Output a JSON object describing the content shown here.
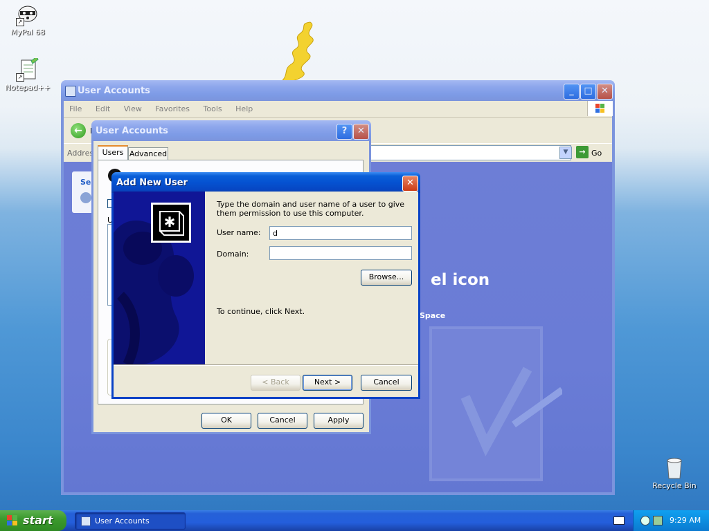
{
  "desktop": {
    "icons": [
      {
        "label": "MyPal 68",
        "icon": "raccoon-icon"
      },
      {
        "label": "Notepad++",
        "icon": "notepad-plus-icon"
      },
      {
        "label": "Recycle Bin",
        "icon": "recycle-bin-icon"
      }
    ]
  },
  "main_window": {
    "title": "User Accounts",
    "menu": [
      "File",
      "Edit",
      "View",
      "Favorites",
      "Tools",
      "Help"
    ],
    "address_label": "Addres",
    "go_label": "Go",
    "back_label": "B",
    "side_text": "Se",
    "bg_heading_fragment": "el icon",
    "bg_sub_fragment": "Space"
  },
  "ua_dialog": {
    "title": "User Accounts",
    "tabs": [
      "Users",
      "Advanced"
    ],
    "left_fragment": "U",
    "buttons": {
      "ok": "OK",
      "cancel": "Cancel",
      "apply": "Apply"
    }
  },
  "add_user": {
    "title": "Add New User",
    "instruction": "Type the domain and user name of a user to give them permission to use this computer.",
    "username_label": "User name:",
    "username_value": "d",
    "domain_label": "Domain:",
    "domain_value": "",
    "browse_label": "Browse...",
    "continue_text": "To continue, click Next.",
    "back_label": "< Back",
    "next_label": "Next >",
    "cancel_label": "Cancel"
  },
  "taskbar": {
    "start_label": "start",
    "task_label": "User Accounts",
    "clock": "9:29 AM"
  }
}
